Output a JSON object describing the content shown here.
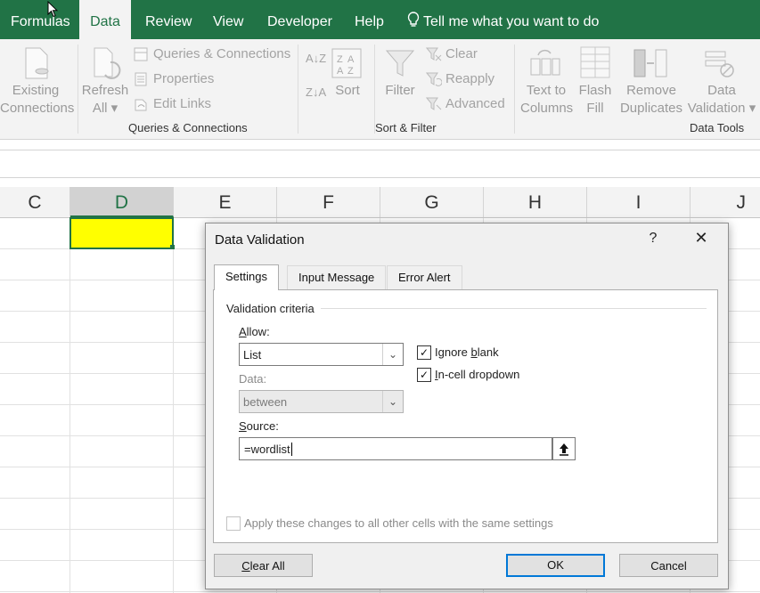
{
  "ribbon_tabs": [
    "Formulas",
    "Data",
    "Review",
    "View",
    "Developer",
    "Help"
  ],
  "tell_me": "Tell me what you want to do",
  "ribbon": {
    "existing_connections": [
      "Existing",
      "Connections"
    ],
    "refresh_all": [
      "Refresh",
      "All"
    ],
    "queries_connections": "Queries & Connections",
    "properties": "Properties",
    "edit_links": "Edit Links",
    "group_queries": "Queries & Connections",
    "sort": "Sort",
    "filter": "Filter",
    "clear": "Clear",
    "reapply": "Reapply",
    "advanced": "Advanced",
    "group_sort_filter": "Sort & Filter",
    "text_to_columns": [
      "Text to",
      "Columns"
    ],
    "flash_fill": [
      "Flash",
      "Fill"
    ],
    "remove_duplicates": [
      "Remove",
      "Duplicates"
    ],
    "data_validation": [
      "Data",
      "Validation"
    ],
    "group_data_tools": "Data Tools"
  },
  "columns": [
    "C",
    "D",
    "E",
    "F",
    "G",
    "H",
    "I",
    "J"
  ],
  "selected_cell_color": "#ffff00",
  "accent": "#217346",
  "dialog": {
    "title": "Data Validation",
    "help": "?",
    "close": "✕",
    "tabs": [
      "Settings",
      "Input Message",
      "Error Alert"
    ],
    "section": "Validation criteria",
    "allow_label": "Allow:",
    "allow_value": "List",
    "ignore_blank": "Ignore blank",
    "in_cell_dropdown": "In-cell dropdown",
    "data_label": "Data:",
    "data_value": "between",
    "source_label": "Source:",
    "source_value": "=wordlist",
    "apply_all": "Apply these changes to all other cells with the same settings",
    "clear_all": "Clear All",
    "ok": "OK",
    "cancel": "Cancel"
  }
}
